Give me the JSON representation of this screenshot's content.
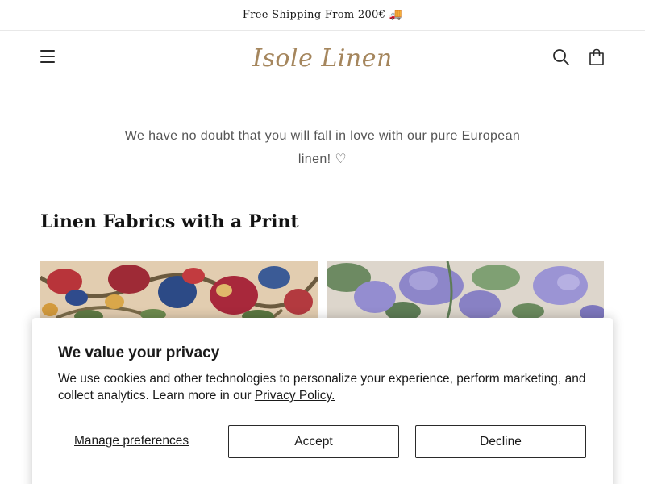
{
  "announcement": {
    "text": "Free Shipping From 200€ 🚚"
  },
  "header": {
    "logo_text": "Isole Linen",
    "menu_icon": "hamburger-menu-icon",
    "search_icon": "search-icon",
    "cart_icon": "shopping-bag-icon"
  },
  "intro": {
    "text": "We have no doubt that you will fall in love with our pure European linen! ♡"
  },
  "collection": {
    "title": "Linen Fabrics with a Print",
    "cards": [
      {
        "image": "floral-print-fabric-red-blue"
      },
      {
        "image": "peony-print-fabric-lavender"
      }
    ]
  },
  "cookie_banner": {
    "title": "We value your privacy",
    "text": "We use cookies and other technologies to personalize your experience, perform marketing, and collect analytics. Learn more in our ",
    "link_text": "Privacy Policy.",
    "manage_label": "Manage preferences",
    "accept_label": "Accept",
    "decline_label": "Decline"
  },
  "colors": {
    "logo": "#a5865d",
    "text_muted": "#555555",
    "text_dark": "#121212",
    "border": "#2a2a2a"
  }
}
